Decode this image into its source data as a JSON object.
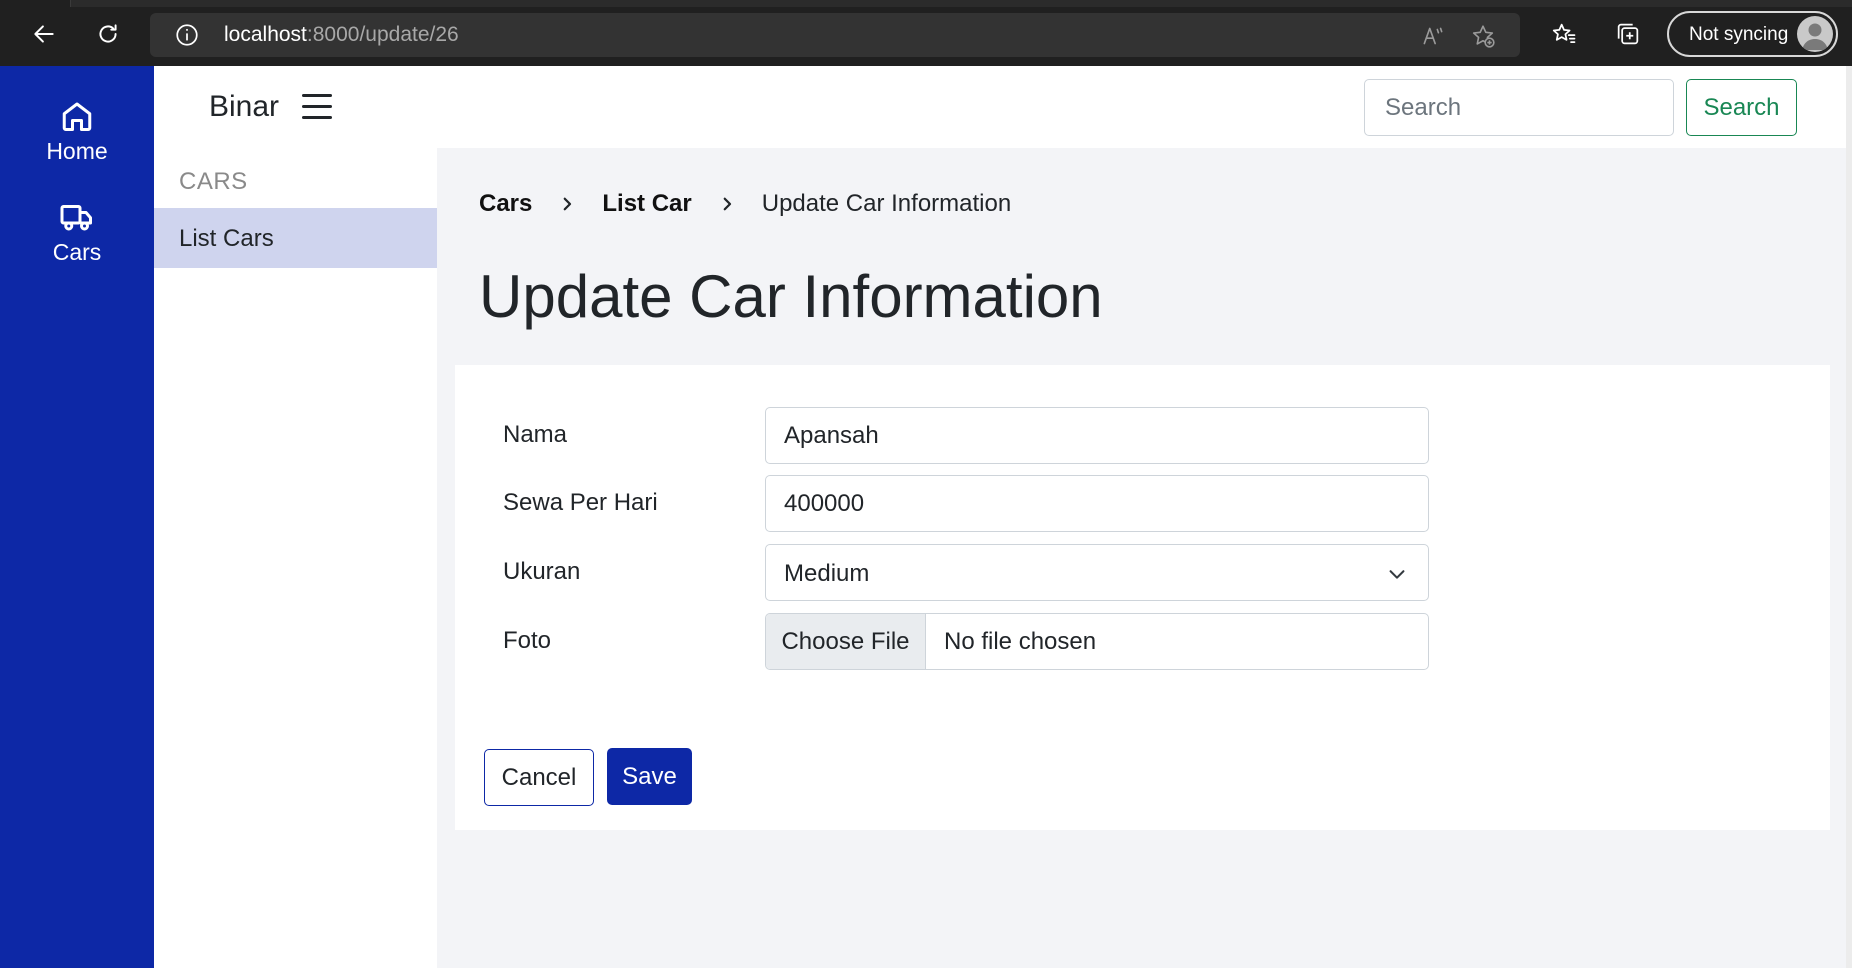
{
  "browser": {
    "url_host": "localhost",
    "url_path": ":8000/update/26",
    "sync_label": "Not syncing",
    "icons": [
      "back-arrow-icon",
      "reload-icon",
      "info-icon",
      "read-aloud-icon",
      "add-favorite-icon",
      "favorites-icon",
      "collections-icon",
      "profile-avatar-icon"
    ]
  },
  "rail": {
    "items": [
      {
        "label": "Home",
        "icon": "home-icon"
      },
      {
        "label": "Cars",
        "icon": "truck-icon"
      }
    ]
  },
  "header": {
    "brand": "Binar",
    "search_placeholder": "Search",
    "search_button": "Search"
  },
  "sidebar": {
    "heading": "CARS",
    "items": [
      {
        "label": "List Cars",
        "active": true
      }
    ]
  },
  "breadcrumb": {
    "items": [
      "Cars",
      "List Car"
    ],
    "current": "Update Car Information"
  },
  "page": {
    "title": "Update Car Information"
  },
  "form": {
    "nama": {
      "label": "Nama",
      "value": "Apansah"
    },
    "sewa": {
      "label": "Sewa Per Hari",
      "value": "400000"
    },
    "ukuran": {
      "label": "Ukuran",
      "value": "Medium"
    },
    "foto": {
      "label": "Foto",
      "button": "Choose File",
      "status": "No file chosen"
    },
    "cancel_label": "Cancel",
    "save_label": "Save"
  },
  "colors": {
    "primary": "#0d28a6",
    "sidebar_active": "#cfd4ee",
    "success": "#198754",
    "content_bg": "#f3f4f7"
  }
}
